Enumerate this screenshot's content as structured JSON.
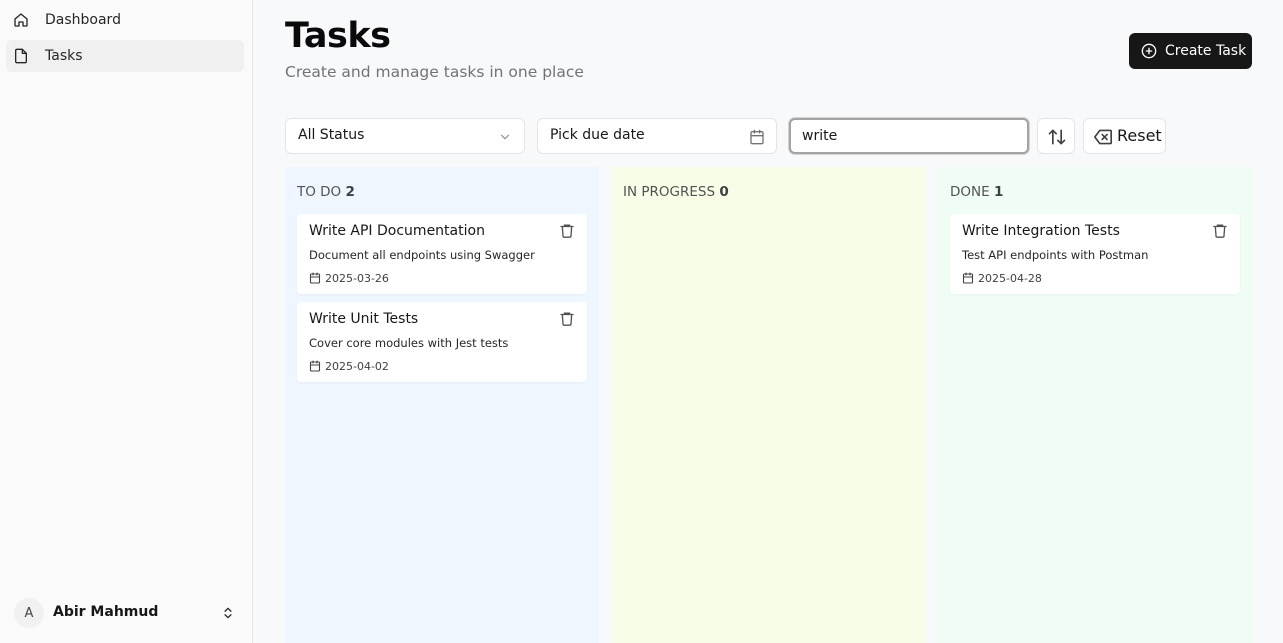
{
  "sidebar": {
    "items": [
      {
        "label": "Dashboard",
        "icon": "home-icon"
      },
      {
        "label": "Tasks",
        "icon": "file-icon"
      }
    ],
    "user": {
      "initial": "A",
      "name": "Abir Mahmud"
    }
  },
  "header": {
    "title": "Tasks",
    "subtitle": "Create and manage tasks in one place",
    "create_label": "Create Task"
  },
  "filters": {
    "status_value": "All Status",
    "due_date_placeholder": "Pick due date",
    "search_value": "write",
    "reset_label": "Reset"
  },
  "columns": [
    {
      "title": "TO DO",
      "count": "2",
      "color": "#eff6ff",
      "tasks": [
        {
          "title": "Write API Documentation",
          "description": "Document all endpoints using Swagger",
          "due": "2025-03-26"
        },
        {
          "title": "Write Unit Tests",
          "description": "Cover core modules with Jest tests",
          "due": "2025-04-02"
        }
      ]
    },
    {
      "title": "IN PROGRESS",
      "count": "0",
      "color": "#f7fee7",
      "tasks": []
    },
    {
      "title": "DONE",
      "count": "1",
      "color": "#f0fdf4",
      "tasks": [
        {
          "title": "Write Integration Tests",
          "description": "Test API endpoints with Postman",
          "due": "2025-04-28"
        }
      ]
    }
  ]
}
